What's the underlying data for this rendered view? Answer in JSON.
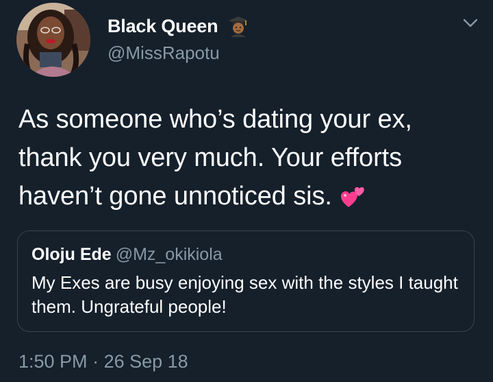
{
  "author": {
    "display_name": "Black Queen",
    "name_emoji": "graduate-emoji",
    "handle": "@MissRapotu"
  },
  "tweet": {
    "text": "As someone who’s dating your ex, thank you very much. Your efforts haven’t gone unnoticed sis.",
    "trailing_emoji": "two-hearts-emoji"
  },
  "quoted_tweet": {
    "display_name": "Oloju Ede",
    "handle": "@Mz_okikiola",
    "text": "My Exes are busy enjoying sex with the styles I taught them. Ungrateful people!"
  },
  "meta": {
    "time": "1:50 PM",
    "separator": "·",
    "date": "26 Sep 18"
  },
  "colors": {
    "background": "#15202b",
    "primary_text": "#ffffff",
    "secondary_text": "#8899a6",
    "border": "#38444d"
  }
}
